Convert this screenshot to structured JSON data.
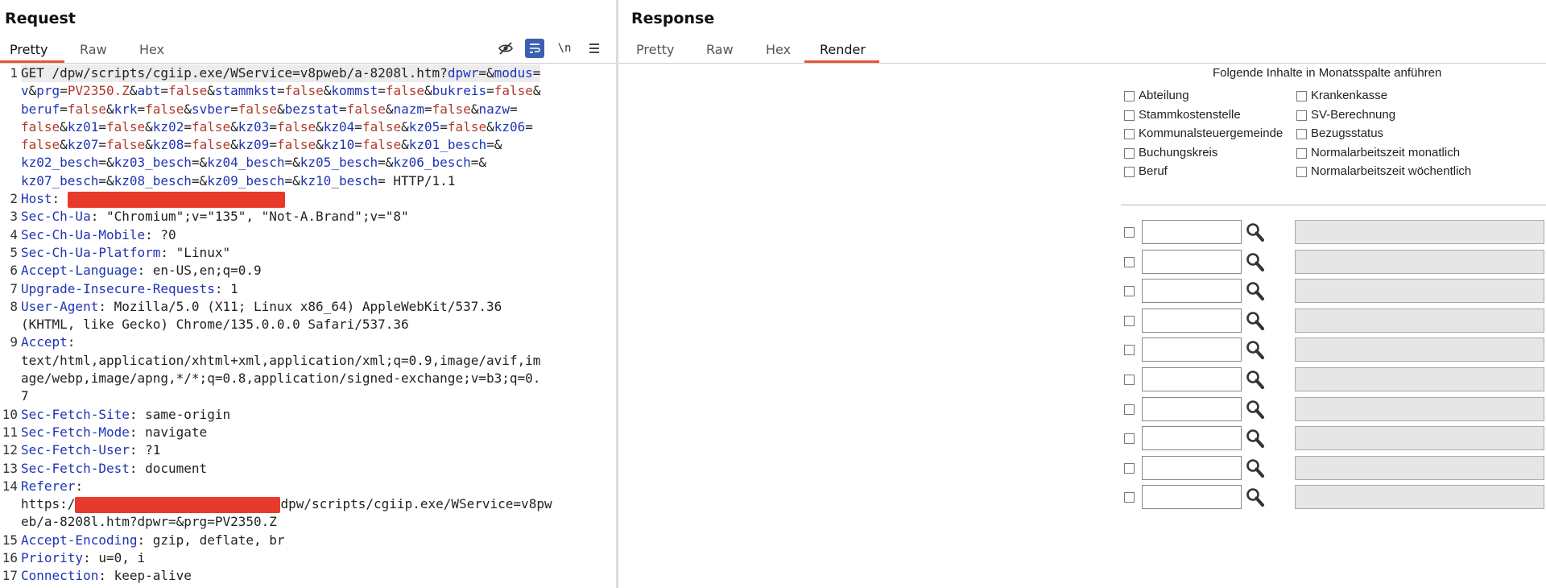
{
  "request": {
    "title": "Request",
    "tabs": [
      "Pretty",
      "Raw",
      "Hex"
    ],
    "active_tab": "Pretty",
    "toolbar_icons": [
      "eye-off-icon",
      "wrap-lines-icon",
      "newline-icon",
      "menu-icon"
    ],
    "lines": [
      {
        "n": "1",
        "hl": true,
        "parts": [
          [
            "t",
            "GET /dpw/scripts/cgiip.exe/WService=v8pweb/a-8208l.htm?"
          ],
          [
            "k",
            "dpwr"
          ],
          [
            "t",
            "=&"
          ],
          [
            "k",
            "modus"
          ],
          [
            "t",
            "="
          ]
        ]
      },
      {
        "n": "",
        "parts": [
          [
            "k",
            "v"
          ],
          [
            "t",
            "&"
          ],
          [
            "k",
            "prg"
          ],
          [
            "t",
            "="
          ],
          [
            "v",
            "PV2350.Z"
          ],
          [
            "t",
            "&"
          ],
          [
            "k",
            "abt"
          ],
          [
            "t",
            "="
          ],
          [
            "v",
            "false"
          ],
          [
            "t",
            "&"
          ],
          [
            "k",
            "stammkst"
          ],
          [
            "t",
            "="
          ],
          [
            "v",
            "false"
          ],
          [
            "t",
            "&"
          ],
          [
            "k",
            "kommst"
          ],
          [
            "t",
            "="
          ],
          [
            "v",
            "false"
          ],
          [
            "t",
            "&"
          ],
          [
            "k",
            "bukreis"
          ],
          [
            "t",
            "="
          ],
          [
            "v",
            "false"
          ],
          [
            "t",
            "&"
          ]
        ]
      },
      {
        "n": "",
        "parts": [
          [
            "k",
            "beruf"
          ],
          [
            "t",
            "="
          ],
          [
            "v",
            "false"
          ],
          [
            "t",
            "&"
          ],
          [
            "k",
            "krk"
          ],
          [
            "t",
            "="
          ],
          [
            "v",
            "false"
          ],
          [
            "t",
            "&"
          ],
          [
            "k",
            "svber"
          ],
          [
            "t",
            "="
          ],
          [
            "v",
            "false"
          ],
          [
            "t",
            "&"
          ],
          [
            "k",
            "bezstat"
          ],
          [
            "t",
            "="
          ],
          [
            "v",
            "false"
          ],
          [
            "t",
            "&"
          ],
          [
            "k",
            "nazm"
          ],
          [
            "t",
            "="
          ],
          [
            "v",
            "false"
          ],
          [
            "t",
            "&"
          ],
          [
            "k",
            "nazw"
          ],
          [
            "t",
            "="
          ]
        ]
      },
      {
        "n": "",
        "parts": [
          [
            "v",
            "false"
          ],
          [
            "t",
            "&"
          ],
          [
            "k",
            "kz01"
          ],
          [
            "t",
            "="
          ],
          [
            "v",
            "false"
          ],
          [
            "t",
            "&"
          ],
          [
            "k",
            "kz02"
          ],
          [
            "t",
            "="
          ],
          [
            "v",
            "false"
          ],
          [
            "t",
            "&"
          ],
          [
            "k",
            "kz03"
          ],
          [
            "t",
            "="
          ],
          [
            "v",
            "false"
          ],
          [
            "t",
            "&"
          ],
          [
            "k",
            "kz04"
          ],
          [
            "t",
            "="
          ],
          [
            "v",
            "false"
          ],
          [
            "t",
            "&"
          ],
          [
            "k",
            "kz05"
          ],
          [
            "t",
            "="
          ],
          [
            "v",
            "false"
          ],
          [
            "t",
            "&"
          ],
          [
            "k",
            "kz06"
          ],
          [
            "t",
            "="
          ]
        ]
      },
      {
        "n": "",
        "parts": [
          [
            "v",
            "false"
          ],
          [
            "t",
            "&"
          ],
          [
            "k",
            "kz07"
          ],
          [
            "t",
            "="
          ],
          [
            "v",
            "false"
          ],
          [
            "t",
            "&"
          ],
          [
            "k",
            "kz08"
          ],
          [
            "t",
            "="
          ],
          [
            "v",
            "false"
          ],
          [
            "t",
            "&"
          ],
          [
            "k",
            "kz09"
          ],
          [
            "t",
            "="
          ],
          [
            "v",
            "false"
          ],
          [
            "t",
            "&"
          ],
          [
            "k",
            "kz10"
          ],
          [
            "t",
            "="
          ],
          [
            "v",
            "false"
          ],
          [
            "t",
            "&"
          ],
          [
            "k",
            "kz01_besch"
          ],
          [
            "t",
            "=&"
          ]
        ]
      },
      {
        "n": "",
        "parts": [
          [
            "k",
            "kz02_besch"
          ],
          [
            "t",
            "=&"
          ],
          [
            "k",
            "kz03_besch"
          ],
          [
            "t",
            "=&"
          ],
          [
            "k",
            "kz04_besch"
          ],
          [
            "t",
            "=&"
          ],
          [
            "k",
            "kz05_besch"
          ],
          [
            "t",
            "=&"
          ],
          [
            "k",
            "kz06_besch"
          ],
          [
            "t",
            "=&"
          ]
        ]
      },
      {
        "n": "",
        "parts": [
          [
            "k",
            "kz07_besch"
          ],
          [
            "t",
            "=&"
          ],
          [
            "k",
            "kz08_besch"
          ],
          [
            "t",
            "=&"
          ],
          [
            "k",
            "kz09_besch"
          ],
          [
            "t",
            "=&"
          ],
          [
            "k",
            "kz10_besch"
          ],
          [
            "t",
            "= HTTP/1.1"
          ]
        ]
      },
      {
        "n": "2",
        "parts": [
          [
            "k",
            "Host"
          ],
          [
            "t",
            ": "
          ],
          [
            "r",
            "270"
          ]
        ]
      },
      {
        "n": "3",
        "parts": [
          [
            "k",
            "Sec-Ch-Ua"
          ],
          [
            "t",
            ": \"Chromium\";v=\"135\", \"Not-A.Brand\";v=\"8\""
          ]
        ]
      },
      {
        "n": "4",
        "parts": [
          [
            "k",
            "Sec-Ch-Ua-Mobile"
          ],
          [
            "t",
            ": ?0"
          ]
        ]
      },
      {
        "n": "5",
        "parts": [
          [
            "k",
            "Sec-Ch-Ua-Platform"
          ],
          [
            "t",
            ": \"Linux\""
          ]
        ]
      },
      {
        "n": "6",
        "parts": [
          [
            "k",
            "Accept-Language"
          ],
          [
            "t",
            ": en-US,en;q=0.9"
          ]
        ]
      },
      {
        "n": "7",
        "parts": [
          [
            "k",
            "Upgrade-Insecure-Requests"
          ],
          [
            "t",
            ": 1"
          ]
        ]
      },
      {
        "n": "8",
        "parts": [
          [
            "k",
            "User-Agent"
          ],
          [
            "t",
            ": Mozilla/5.0 (X11; Linux x86_64) AppleWebKit/537.36"
          ]
        ]
      },
      {
        "n": "",
        "parts": [
          [
            "t",
            "(KHTML, like Gecko) Chrome/135.0.0.0 Safari/537.36"
          ]
        ]
      },
      {
        "n": "9",
        "parts": [
          [
            "k",
            "Accept"
          ],
          [
            "t",
            ":"
          ]
        ]
      },
      {
        "n": "",
        "parts": [
          [
            "t",
            "text/html,application/xhtml+xml,application/xml;q=0.9,image/avif,im"
          ]
        ]
      },
      {
        "n": "",
        "parts": [
          [
            "t",
            "age/webp,image/apng,*/*;q=0.8,application/signed-exchange;v=b3;q=0."
          ]
        ]
      },
      {
        "n": "",
        "parts": [
          [
            "t",
            "7"
          ]
        ]
      },
      {
        "n": "10",
        "parts": [
          [
            "k",
            "Sec-Fetch-Site"
          ],
          [
            "t",
            ": same-origin"
          ]
        ]
      },
      {
        "n": "11",
        "parts": [
          [
            "k",
            "Sec-Fetch-Mode"
          ],
          [
            "t",
            ": navigate"
          ]
        ]
      },
      {
        "n": "12",
        "parts": [
          [
            "k",
            "Sec-Fetch-User"
          ],
          [
            "t",
            ": ?1"
          ]
        ]
      },
      {
        "n": "13",
        "parts": [
          [
            "k",
            "Sec-Fetch-Dest"
          ],
          [
            "t",
            ": document"
          ]
        ]
      },
      {
        "n": "14",
        "parts": [
          [
            "k",
            "Referer"
          ],
          [
            "t",
            ":"
          ]
        ]
      },
      {
        "n": "",
        "parts": [
          [
            "t",
            "https:/"
          ],
          [
            "r",
            "255"
          ],
          [
            "t",
            "dpw/scripts/cgiip.exe/WService=v8pw"
          ]
        ]
      },
      {
        "n": "",
        "parts": [
          [
            "t",
            "eb/a-8208l.htm?dpwr=&prg=PV2350.Z"
          ]
        ]
      },
      {
        "n": "15",
        "parts": [
          [
            "k",
            "Accept-Encoding"
          ],
          [
            "t",
            ": gzip, deflate, br"
          ]
        ]
      },
      {
        "n": "16",
        "parts": [
          [
            "k",
            "Priority"
          ],
          [
            "t",
            ": u=0, i"
          ]
        ]
      },
      {
        "n": "17",
        "parts": [
          [
            "k",
            "Connection"
          ],
          [
            "t",
            ": keep-alive"
          ]
        ]
      }
    ]
  },
  "response": {
    "title": "Response",
    "tabs": [
      "Pretty",
      "Raw",
      "Hex",
      "Render"
    ],
    "active_tab": "Render",
    "render": {
      "heading": "Folgende Inhalte in Monatsspalte anführen",
      "options_left": [
        "Abteilung",
        "Stammkostenstelle",
        "Kommunalsteuergemeinde",
        "Buchungskreis",
        "Beruf"
      ],
      "options_right": [
        "Krankenkasse",
        "SV-Berechnung",
        "Bezugsstatus",
        "Normalarbeitszeit monatlich",
        "Normalarbeitszeit wöchentlich"
      ],
      "row_count": 10
    }
  },
  "colors": {
    "key": "#1f34b5",
    "value": "#b13a2b",
    "redaction": "#e83a2a",
    "tab_underline": "#e8553a",
    "active_icon": "#3c5fb0"
  }
}
